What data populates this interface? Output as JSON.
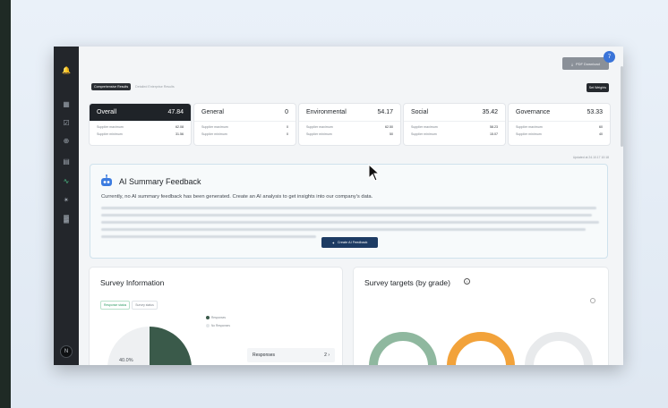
{
  "header": {
    "pdf_download_label": "PDF Download",
    "notification_count": "7"
  },
  "tabs": [
    {
      "label": "Comprehensive Results"
    },
    {
      "label": "Detailed Enterprise Results"
    }
  ],
  "set_weights_label": "Set Weights",
  "scores": [
    {
      "title": "Overall",
      "value": "47.84",
      "rows": [
        {
          "label": "Supplier maximum",
          "value": "62.08"
        },
        {
          "label": "Supplier minimum",
          "value": "31.56"
        }
      ]
    },
    {
      "title": "General",
      "value": "0",
      "rows": [
        {
          "label": "Supplier maximum",
          "value": "0"
        },
        {
          "label": "Supplier minimum",
          "value": "0"
        }
      ]
    },
    {
      "title": "Environmental",
      "value": "54.17",
      "rows": [
        {
          "label": "Supplier maximum",
          "value": "62.50"
        },
        {
          "label": "Supplier minimum",
          "value": "50"
        }
      ]
    },
    {
      "title": "Social",
      "value": "35.42",
      "rows": [
        {
          "label": "Supplier maximum",
          "value": "58.23"
        },
        {
          "label": "Supplier minimum",
          "value": "15.07"
        }
      ]
    },
    {
      "title": "Governance",
      "value": "53.33",
      "rows": [
        {
          "label": "Supplier maximum",
          "value": "60"
        },
        {
          "label": "Supplier minimum",
          "value": "40"
        }
      ]
    }
  ],
  "updated_text": "Updated at 24.10.17 10:18",
  "ai_summary": {
    "title": "AI Summary Feedback",
    "description": "Currently, no AI summary feedback has been generated. Create an AI analysis to get insights into our company's data.",
    "button_label": "Create AI Feedback"
  },
  "survey_info": {
    "title": "Survey Information",
    "sub_tabs": [
      "Response status",
      "Survey status"
    ],
    "legend": [
      "Responses",
      "No Responses"
    ],
    "pie_value": 40,
    "pie_label": "40.0%",
    "responses_label": "Responses",
    "responses_value": "2"
  },
  "survey_targets": {
    "title": "Survey targets (by grade)"
  },
  "colors": {
    "pie_main": "#3a5a4a",
    "ring_green": "#8fb89f",
    "ring_orange": "#f2a23a",
    "ring_gray": "#e8eaec",
    "accent": "#1d3b63"
  },
  "sidebar": {
    "avatar_initial": "N",
    "icons": [
      "bell-icon",
      "dashboard-icon",
      "checklist-icon",
      "search-zoom-icon",
      "document-icon",
      "trend-icon",
      "network-icon",
      "building-icon"
    ]
  }
}
